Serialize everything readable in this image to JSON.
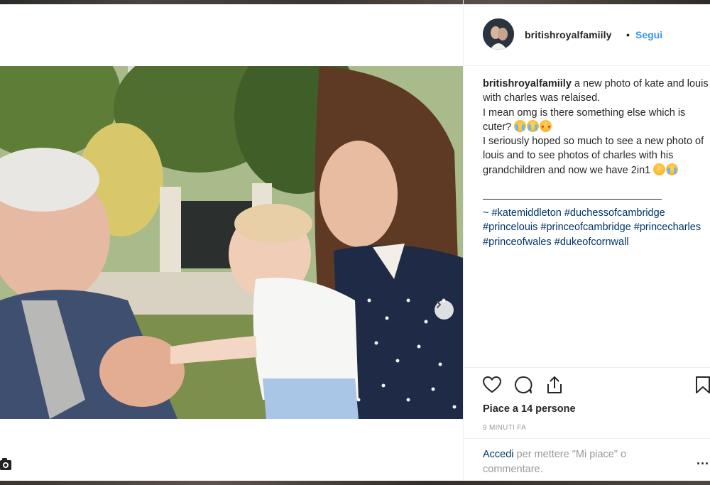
{
  "post": {
    "username": "britishroyalfamiily",
    "separator": "•",
    "follow_label": "Segui",
    "caption": {
      "user": "britishroyalfamiily",
      "line1": " a new photo of kate and louis with charles was relaised.",
      "line2": "I mean omg is there something else which is cuter? ",
      "line3": "I seriously hoped so much to see a new photo of louis and to see photos of charles with his grandchildren and now we have 2in1 ",
      "hashtags": "~ #katemiddleton #duchessofcambridge #princelouis #princeofcambridge #princecharles #princeofwales #dukeofcornwall"
    },
    "likes_label": "Piace a 14 persone",
    "time_label": "9 MINUTI FA",
    "login_link": "Accedi",
    "login_text": " per mettere \"Mi piace\" o commentare.",
    "more_label": "..."
  },
  "icons": {
    "like": "heart-icon",
    "comment": "comment-icon",
    "share": "share-icon",
    "save": "bookmark-icon",
    "next": "chevron-right-icon",
    "camera": "camera-icon"
  },
  "colors": {
    "link_blue": "#3897f0",
    "hashtag_navy": "#003569",
    "muted": "#999999",
    "text": "#262626"
  }
}
